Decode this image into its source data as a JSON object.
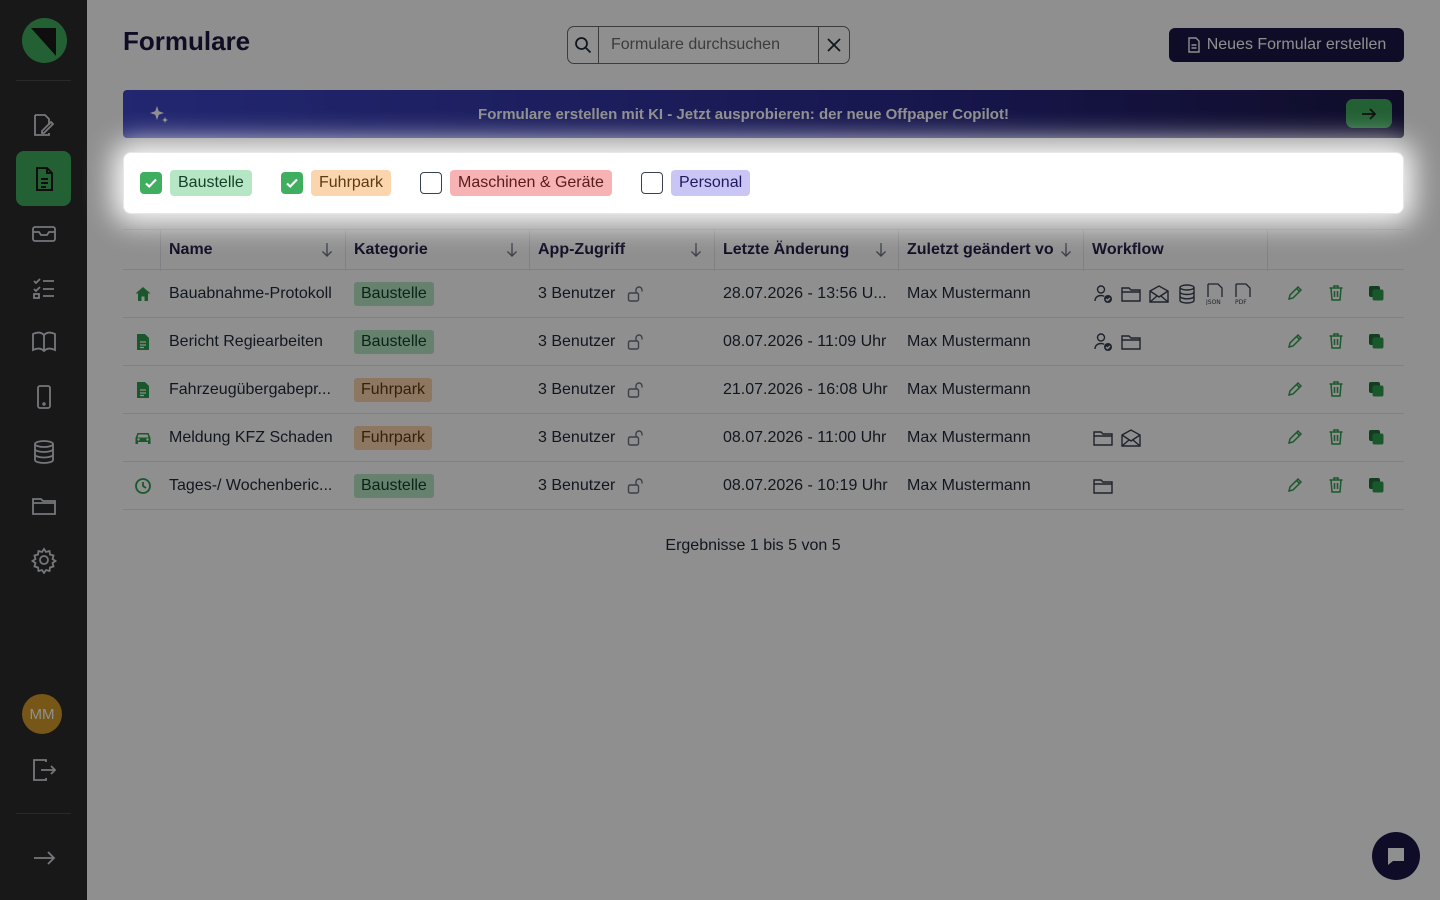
{
  "page": {
    "title": "Formulare"
  },
  "search": {
    "placeholder": "Formulare durchsuchen"
  },
  "new_button": {
    "label": "Neues Formular erstellen"
  },
  "banner": {
    "text": "Formulare erstellen mit KI - Jetzt ausprobieren: der neue Offpaper Copilot!"
  },
  "sidebar": {
    "items": [
      {
        "name": "sidebar-item-editor",
        "icon": "edit-document-icon",
        "active": false
      },
      {
        "name": "sidebar-item-forms",
        "icon": "document-icon",
        "active": true
      },
      {
        "name": "sidebar-item-inbox",
        "icon": "inbox-icon",
        "active": false
      },
      {
        "name": "sidebar-item-tasks",
        "icon": "checklist-icon",
        "active": false
      },
      {
        "name": "sidebar-item-docs",
        "icon": "book-icon",
        "active": false
      },
      {
        "name": "sidebar-item-app",
        "icon": "phone-icon",
        "active": false
      },
      {
        "name": "sidebar-item-database",
        "icon": "database-icon",
        "active": false
      },
      {
        "name": "sidebar-item-files",
        "icon": "folder-icon",
        "active": false
      },
      {
        "name": "sidebar-item-settings",
        "icon": "gear-icon",
        "active": false
      }
    ],
    "avatar_initials": "MM"
  },
  "filters": [
    {
      "label": "Baustelle",
      "checked": true,
      "bg": "#b6e7c4",
      "fg": "#15402a"
    },
    {
      "label": "Fuhrpark",
      "checked": true,
      "bg": "#fbd5ae",
      "fg": "#5b3a16"
    },
    {
      "label": "Maschinen & Geräte",
      "checked": false,
      "bg": "#f7b3b3",
      "fg": "#5a1b1b"
    },
    {
      "label": "Personal",
      "checked": false,
      "bg": "#c9c6f5",
      "fg": "#1e1a5e"
    }
  ],
  "table": {
    "headers": [
      "Name",
      "Kategorie",
      "App-Zugriff",
      "Letzte Änderung",
      "Zuletzt geändert vo",
      "Workflow"
    ],
    "rows": [
      {
        "icon": "home-icon",
        "name": "Bauabnahme-Protokoll",
        "category": "Baustelle",
        "access": "3 Benutzer",
        "changed": "28.07.2026 - 13:56 U...",
        "by": "Max Mustermann",
        "workflow": [
          "user-check-icon",
          "folder-icon",
          "mail-icon",
          "database-icon",
          "json-file-icon",
          "pdf-file-icon"
        ]
      },
      {
        "icon": "document-icon",
        "name": "Bericht Regiearbeiten",
        "category": "Baustelle",
        "access": "3 Benutzer",
        "changed": "08.07.2026 - 11:09 Uhr",
        "by": "Max Mustermann",
        "workflow": [
          "user-check-icon",
          "folder-icon"
        ]
      },
      {
        "icon": "document-icon",
        "name": "Fahrzeugübergabepr...",
        "category": "Fuhrpark",
        "access": "3 Benutzer",
        "changed": "21.07.2026 - 16:08 Uhr",
        "by": "Max Mustermann",
        "workflow": []
      },
      {
        "icon": "car-icon",
        "name": "Meldung KFZ Schaden",
        "category": "Fuhrpark",
        "access": "3 Benutzer",
        "changed": "08.07.2026 - 11:00 Uhr",
        "by": "Max Mustermann",
        "workflow": [
          "folder-icon",
          "mail-icon"
        ]
      },
      {
        "icon": "clock-icon",
        "name": "Tages-/ Wochenberic...",
        "category": "Baustelle",
        "access": "3 Benutzer",
        "changed": "08.07.2026 - 10:19 Uhr",
        "by": "Max Mustermann",
        "workflow": [
          "folder-icon"
        ]
      }
    ]
  },
  "results_text": "Ergebnisse 1 bis 5 von 5",
  "colors": {
    "accent": "#3fae5f",
    "brand_dark": "#1b1646",
    "sidebar": "#2b2b2b"
  }
}
